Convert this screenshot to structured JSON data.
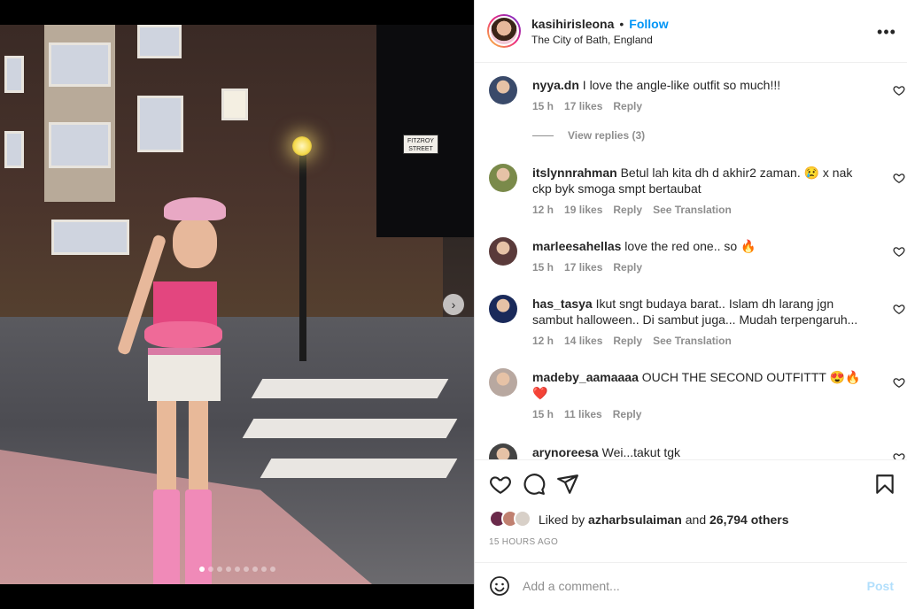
{
  "header": {
    "username": "kasihirisleona",
    "bullet": "•",
    "follow_label": "Follow",
    "location": "The City of Bath, England",
    "more_label": "•••"
  },
  "photo": {
    "street_sign": "FITZROY STREET",
    "carousel_total": 9,
    "carousel_active": 1,
    "next_icon": "›"
  },
  "comments": [
    {
      "username": "nyya.dn",
      "text": "I love the angle-like outfit so much!!!",
      "time": "15 h",
      "likes": "17 likes",
      "reply": "Reply",
      "translation": "",
      "avatar_color": "#3a4a6a"
    },
    {
      "username": "itslynnrahman",
      "text": "Betul lah kita dh d akhir2 zaman. 😢 x nak ckp byk smoga smpt bertaubat",
      "time": "12 h",
      "likes": "19 likes",
      "reply": "Reply",
      "translation": "See Translation",
      "avatar_color": "#7a8a4a"
    },
    {
      "username": "marleesahellas",
      "text": "love the red one.. so 🔥",
      "time": "15 h",
      "likes": "17 likes",
      "reply": "Reply",
      "translation": "",
      "avatar_color": "#5a3a3a"
    },
    {
      "username": "has_tasya",
      "text": "Ikut sngt budaya barat.. Islam dh larang jgn sambut halloween.. Di sambut juga... Mudah terpengaruh...",
      "time": "12 h",
      "likes": "14 likes",
      "reply": "Reply",
      "translation": "See Translation",
      "avatar_color": "#1a2a5a"
    },
    {
      "username": "madeby_aamaaaa",
      "text": "OUCH THE SECOND OUTFITTT 😍🔥❤️",
      "time": "15 h",
      "likes": "11 likes",
      "reply": "Reply",
      "translation": "",
      "avatar_color": "#b8a8a0"
    },
    {
      "username": "arynoreesa",
      "text": "Wei...takut tgk",
      "time": "",
      "likes": "",
      "reply": "",
      "translation": "",
      "avatar_color": "#444444"
    }
  ],
  "view_replies": "View replies (3)",
  "likes": {
    "prefix": "Liked by",
    "user": "azharbsulaiman",
    "and": "and",
    "others": "26,794 others",
    "liker_colors": [
      "#6a2a4a",
      "#c08070",
      "#d8d0c8"
    ]
  },
  "timestamp": "15 HOURS AGO",
  "composer": {
    "placeholder": "Add a comment...",
    "post_label": "Post"
  },
  "colors": {
    "link_blue": "#0095f6",
    "post_disabled": "#b2dffc",
    "muted": "#8e8e8e",
    "text": "#262626"
  }
}
